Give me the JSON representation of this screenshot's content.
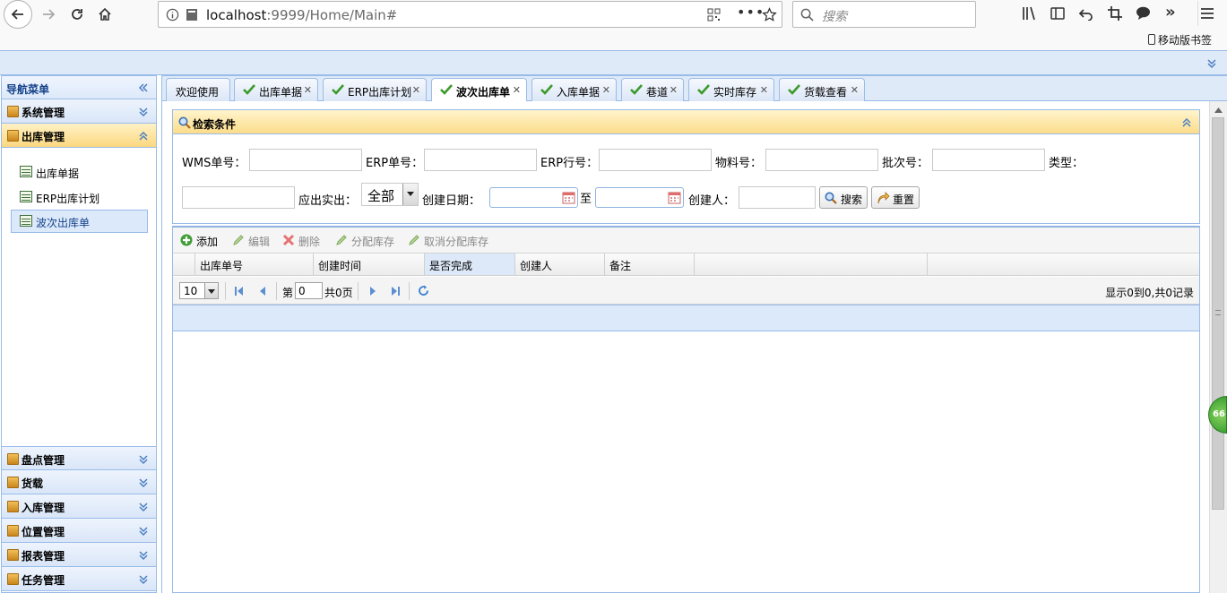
{
  "browser": {
    "url_host": "localhost",
    "url_rest": ":9999/Home/Main#",
    "search_placeholder": "搜索",
    "mobile_bookmarks": "移动版书签"
  },
  "sidebar": {
    "title": "导航菜单",
    "groups_top": [
      {
        "label": "系统管理",
        "open": false
      },
      {
        "label": "出库管理",
        "open": true
      }
    ],
    "items": [
      {
        "label": "出库单据",
        "selected": false
      },
      {
        "label": "ERP出库计划",
        "selected": false
      },
      {
        "label": "波次出库单",
        "selected": true
      }
    ],
    "groups_bottom": [
      {
        "label": "盘点管理"
      },
      {
        "label": "货载"
      },
      {
        "label": "入库管理"
      },
      {
        "label": "位置管理"
      },
      {
        "label": "报表管理"
      },
      {
        "label": "任务管理"
      }
    ]
  },
  "tabs": [
    {
      "label": "欢迎使用",
      "icon": false,
      "close": false
    },
    {
      "label": "出库单据",
      "icon": true,
      "close": true
    },
    {
      "label": "ERP出库计划",
      "icon": true,
      "close": true
    },
    {
      "label": "波次出库单",
      "icon": true,
      "close": true,
      "active": true
    },
    {
      "label": "入库单据",
      "icon": true,
      "close": true
    },
    {
      "label": "巷道",
      "icon": true,
      "close": true
    },
    {
      "label": "实时库存",
      "icon": true,
      "close": true
    },
    {
      "label": "货载查看",
      "icon": true,
      "close": true
    }
  ],
  "search": {
    "title": "检索条件",
    "labels": {
      "wms": "WMS单号：",
      "erp_no": "ERP单号：",
      "erp_line": "ERP行号：",
      "material": "物料号：",
      "batch": "批次号：",
      "type": "类型：",
      "should_out": "应出实出：",
      "create_date": "创建日期：",
      "to": "至",
      "creator": "创建人："
    },
    "select_value": "全部",
    "search_button": "搜索",
    "reset_button": "重置"
  },
  "toolbar": {
    "add": "添加",
    "edit": "编辑",
    "delete": "删除",
    "assign": "分配库存",
    "cancel_assign": "取消分配库存"
  },
  "columns": [
    "出库单号",
    "创建时间",
    "是否完成",
    "创建人",
    "备注"
  ],
  "pager": {
    "page_size": "10",
    "page_prefix": "第",
    "page_value": "0",
    "page_total": "共0页",
    "summary": "显示0到0,共0记录"
  },
  "badge": "66",
  "colors": {
    "border": "#99bbe8",
    "header_blue": "#dfeaf8",
    "active_yellow": "#fbd87f",
    "title_blue": "#15428b"
  }
}
